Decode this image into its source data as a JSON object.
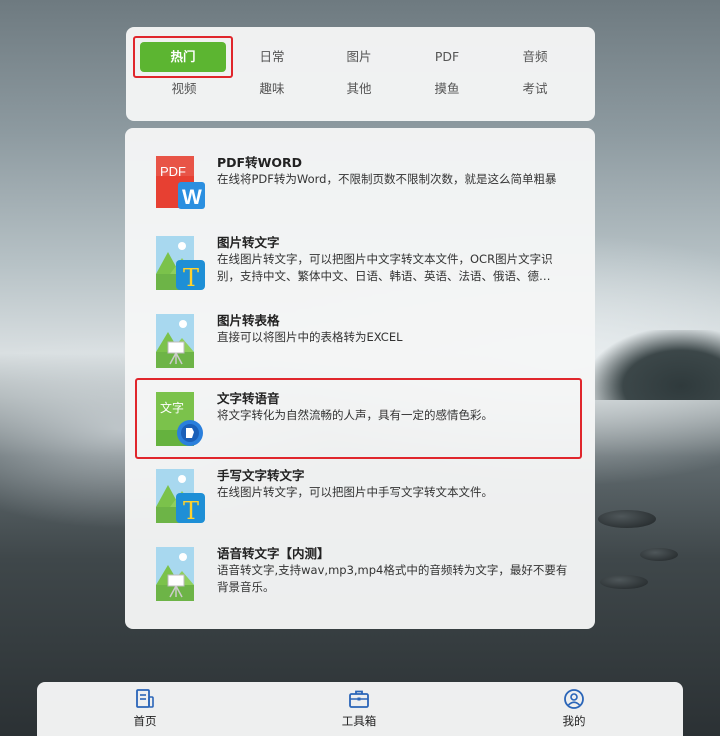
{
  "categories": [
    {
      "label": "热门",
      "active": true
    },
    {
      "label": "日常"
    },
    {
      "label": "图片"
    },
    {
      "label": "PDF"
    },
    {
      "label": "音频"
    },
    {
      "label": "视频"
    },
    {
      "label": "趣味"
    },
    {
      "label": "其他"
    },
    {
      "label": "摸鱼"
    },
    {
      "label": "考试"
    }
  ],
  "tools": [
    {
      "title": "PDF转WORD",
      "desc": "在线将PDF转为Word，不限制页数不限制次数，就是这么简单粗暴",
      "icon": "pdf-to-word-icon",
      "icon_text": "PDF",
      "badge": "W"
    },
    {
      "title": "图片转文字",
      "desc": "在线图片转文字，可以把图片中文字转文本文件，OCR图片文字识别，支持中文、繁体中文、日语、韩语、英语、法语、俄语、德…",
      "icon": "image-to-text-icon",
      "badge": "T"
    },
    {
      "title": "图片转表格",
      "desc": "直接可以将图片中的表格转为EXCEL",
      "icon": "image-to-table-icon"
    },
    {
      "title": "文字转语音",
      "desc": "将文字转化为自然流畅的人声，具有一定的感情色彩。",
      "icon": "text-to-speech-icon",
      "icon_text": "文字"
    },
    {
      "title": "手写文字转文字",
      "desc": "在线图片转文字，可以把图片中手写文字转文本文件。",
      "icon": "handwriting-to-text-icon",
      "badge": "T"
    },
    {
      "title": "语音转文字【内测】",
      "desc": "语音转文字,支持wav,mp3,mp4格式中的音频转为文字，最好不要有背景音乐。",
      "icon": "speech-to-text-icon"
    }
  ],
  "nav": [
    {
      "label": "首页",
      "icon": "home-doc-icon"
    },
    {
      "label": "工具箱",
      "icon": "toolbox-icon"
    },
    {
      "label": "我的",
      "icon": "user-icon"
    }
  ],
  "colors": {
    "accent": "#5cb531",
    "highlight": "#e0262c",
    "panel": "#f5f6f6"
  }
}
